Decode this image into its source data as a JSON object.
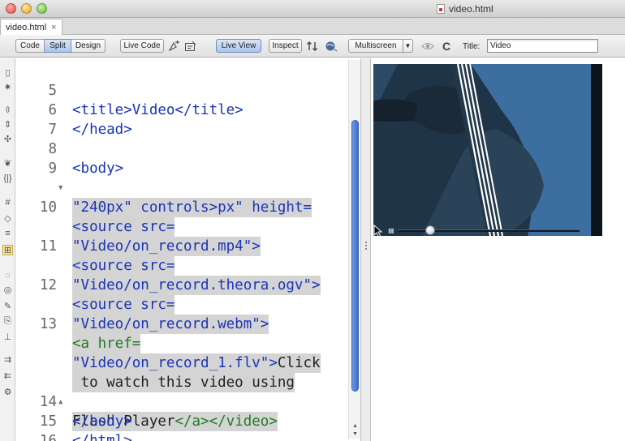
{
  "window": {
    "title": "video.html",
    "tab_label": "video.html",
    "tab_close": "×"
  },
  "toolbar": {
    "code": "Code",
    "split": "Split",
    "design": "Design",
    "live_code": "Live Code",
    "live_view": "Live View",
    "inspect": "Inspect",
    "multiscreen": "Multiscreen",
    "title_label": "Title:",
    "title_value": "Video"
  },
  "editor": {
    "lines": [
      {
        "num": "5",
        "text": "<title>Video</title>"
      },
      {
        "num": "6",
        "text": "</head>"
      },
      {
        "num": "7",
        "text": ""
      },
      {
        "num": "8",
        "text": "<body>"
      },
      {
        "num": "9",
        "text": "<video width=\"320px\" height=",
        "fold": "▼"
      },
      {
        "num": "",
        "text": "\"240px\" controls>"
      },
      {
        "num": "10",
        "text": "<source src="
      },
      {
        "num": "",
        "text": "\"Video/on_record.mp4\">"
      },
      {
        "num": "11",
        "text": "<source src="
      },
      {
        "num": "",
        "text": "\"Video/on_record.theora.ogv\">"
      },
      {
        "num": "12",
        "text": "<source src="
      },
      {
        "num": "",
        "text": "\"Video/on_record.webm\">"
      },
      {
        "num": "13",
        "text": "<a href="
      },
      {
        "num": "",
        "text": "\"Video/on_record_1.flv\">",
        "text2": "Click"
      },
      {
        "num": "",
        "text": " to watch this video using"
      },
      {
        "num": "",
        "text": "Flash Player",
        "text2": "</a></video>",
        "fold": "▲"
      },
      {
        "num": "14",
        "text": "</body>"
      },
      {
        "num": "15",
        "text": "</html>"
      },
      {
        "num": "16",
        "text": ""
      }
    ]
  },
  "video": {
    "state": "paused",
    "progress": 0.18
  }
}
